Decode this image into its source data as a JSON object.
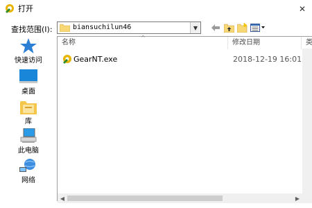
{
  "window": {
    "title": "打开"
  },
  "lookin": {
    "label": "查找范围(I):",
    "value": "biansuchilun46"
  },
  "places": [
    {
      "label": "快速访问",
      "icon": "star-icon"
    },
    {
      "label": "桌面",
      "icon": "desktop-icon"
    },
    {
      "label": "库",
      "icon": "library-icon"
    },
    {
      "label": "此电脑",
      "icon": "computer-icon"
    },
    {
      "label": "网络",
      "icon": "network-icon"
    }
  ],
  "columns": {
    "name": "名称",
    "date": "修改日期",
    "extra": "类"
  },
  "files": [
    {
      "name": "GearNT.exe",
      "date": "2018-12-19 16:01"
    }
  ],
  "colors": {
    "accent": "#0078d7",
    "folder": "#f8d775"
  }
}
